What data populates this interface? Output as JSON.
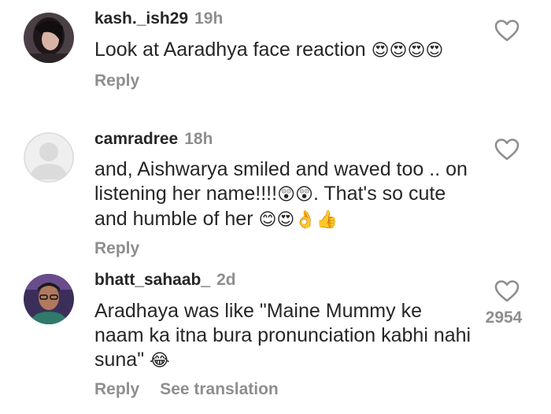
{
  "comments": [
    {
      "username": "kash._ish29",
      "time": "19h",
      "text": "Look at Aaradhya face reaction ",
      "emojis": "😍😍😍😍",
      "reply_label": "Reply",
      "avatar_icon": "user-photo-dark-hair"
    },
    {
      "username": "camradree",
      "time": "18h",
      "text": "and, Aishwarya smiled and waved too .. on listening her name!!!!",
      "emojis_1": "😲😲",
      "text_2": ". That's so cute and humble of her ",
      "emojis_2": "😊😍👌👍",
      "reply_label": "Reply",
      "avatar_icon": "default-profile-icon"
    },
    {
      "username": "bhatt_sahaab_",
      "time": "2d",
      "text": "Aradhaya was like \"Maine Mummy ke naam ka itna bura pronunciation kabhi nahi suna\" ",
      "emojis": "😂",
      "reply_label": "Reply",
      "see_translation_label": "See translation",
      "like_count": "2954",
      "avatar_icon": "user-photo-glasses"
    }
  ],
  "colors": {
    "text": "#262626",
    "secondary": "#8e8e8e"
  }
}
